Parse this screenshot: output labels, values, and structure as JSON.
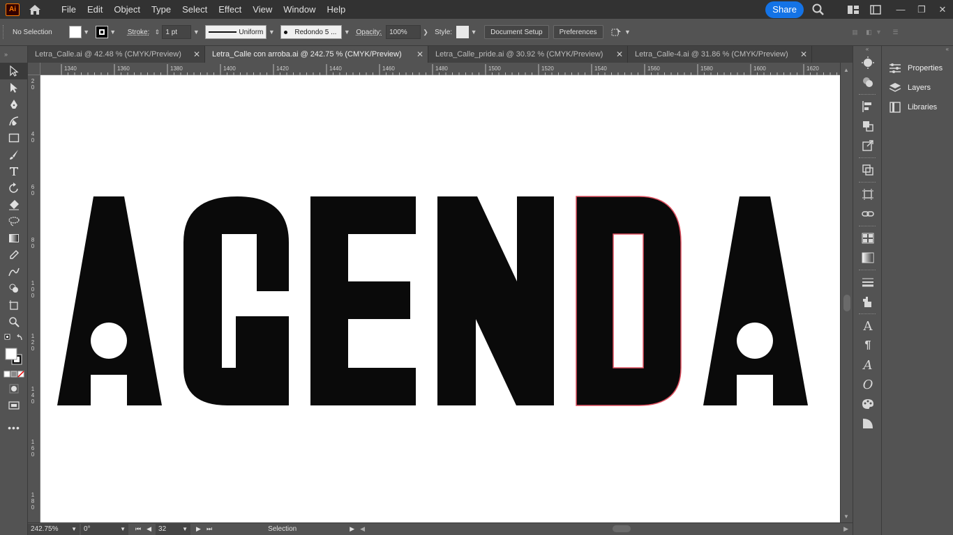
{
  "app": {
    "logo_text": "Ai"
  },
  "menu": [
    "File",
    "Edit",
    "Object",
    "Type",
    "Select",
    "Effect",
    "View",
    "Window",
    "Help"
  ],
  "topright": {
    "share_label": "Share"
  },
  "control": {
    "selection_label": "No Selection",
    "stroke_label": "Stroke:",
    "stroke_weight": "1 pt",
    "stroke_profile": "Uniform",
    "brush": "Redondo 5 ...",
    "opacity_label": "Opacity:",
    "opacity_value": "100%",
    "style_label": "Style:",
    "document_setup": "Document Setup",
    "preferences": "Preferences"
  },
  "tabs": [
    {
      "label": "Letra_Calle.ai @ 42.48 % (CMYK/Preview)",
      "active": false
    },
    {
      "label": "Letra_Calle con arroba.ai @ 242.75 % (CMYK/Preview)",
      "active": true
    },
    {
      "label": "Letra_Calle_pride.ai @ 30.92 % (CMYK/Preview)",
      "active": false
    },
    {
      "label": "Letra_Calle-4.ai @ 31.86 % (CMYK/Preview)",
      "active": false
    }
  ],
  "ruler_h": [
    "1340",
    "1360",
    "1380",
    "1400",
    "1420",
    "1440",
    "1460",
    "1480",
    "1500",
    "1520",
    "1540",
    "1560",
    "1580",
    "1600",
    "1620"
  ],
  "ruler_v": [
    "20",
    "40",
    "60",
    "80",
    "100",
    "120",
    "140",
    "160",
    "180"
  ],
  "artwork": {
    "letters": [
      "A",
      "G",
      "E",
      "N",
      "D",
      "A"
    ],
    "selected_letter_outline_color": "#e05060",
    "fill_color": "#0a0a0a"
  },
  "status": {
    "zoom": "242.75%",
    "rotation": "0°",
    "artboard": "32",
    "tool": "Selection"
  },
  "panels": {
    "properties": "Properties",
    "layers": "Layers",
    "libraries": "Libraries"
  }
}
